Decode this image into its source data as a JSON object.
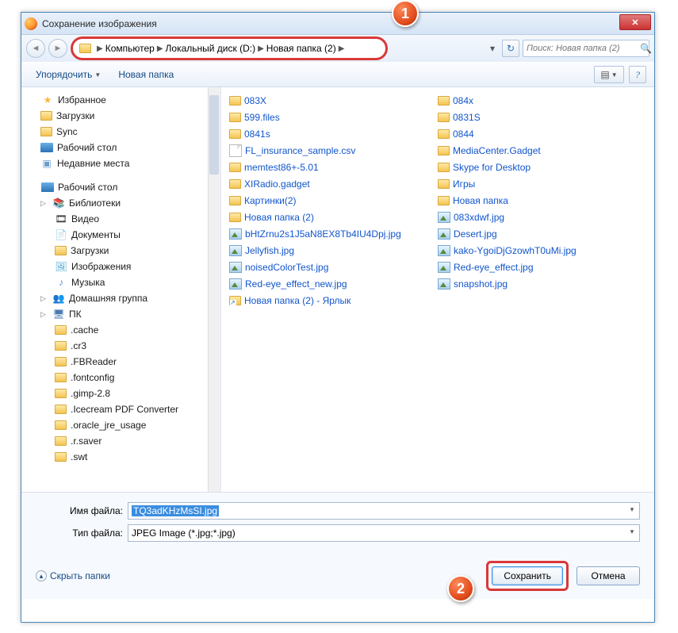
{
  "window": {
    "title": "Сохранение изображения"
  },
  "callouts": {
    "one": "1",
    "two": "2"
  },
  "nav": {
    "crumbs": [
      "Компьютер",
      "Локальный диск (D:)",
      "Новая папка (2)"
    ],
    "search_placeholder": "Поиск: Новая папка (2)"
  },
  "toolbar": {
    "organize": "Упорядочить",
    "new_folder": "Новая папка"
  },
  "sidebar": {
    "favorites": "Избранное",
    "fav_items": [
      "Загрузки",
      "Sync",
      "Рабочий стол",
      "Недавние места"
    ],
    "desktop": "Рабочий стол",
    "libraries": "Библиотеки",
    "lib_items": [
      "Видео",
      "Документы",
      "Загрузки",
      "Изображения",
      "Музыка"
    ],
    "homegroup": "Домашняя группа",
    "computer": "ПК",
    "pc_folders": [
      ".cache",
      ".cr3",
      ".FBReader",
      ".fontconfig",
      ".gimp-2.8",
      ".Icecream PDF Converter",
      ".oracle_jre_usage",
      ".r.saver",
      ".swt"
    ]
  },
  "files": {
    "col1": [
      {
        "t": "folder",
        "n": "083X"
      },
      {
        "t": "folder",
        "n": "599.files"
      },
      {
        "t": "folder",
        "n": "0841s"
      },
      {
        "t": "file",
        "n": "FL_insurance_sample.csv"
      },
      {
        "t": "folder",
        "n": "memtest86+-5.01"
      },
      {
        "t": "folder",
        "n": "XIRadio.gadget"
      },
      {
        "t": "folder",
        "n": "Картинки(2)"
      },
      {
        "t": "folder",
        "n": "Новая папка (2)"
      },
      {
        "t": "img",
        "n": "bHtZrnu2s1J5aN8EX8Tb4IU4Dpj.jpg"
      },
      {
        "t": "img",
        "n": "Jellyfish.jpg"
      },
      {
        "t": "img",
        "n": "noisedColorTest.jpg"
      },
      {
        "t": "img",
        "n": "Red-eye_effect_new.jpg"
      },
      {
        "t": "shortcut",
        "n": "Новая папка (2) - Ярлык"
      }
    ],
    "col2": [
      {
        "t": "folder",
        "n": "084x"
      },
      {
        "t": "folder",
        "n": "0831S"
      },
      {
        "t": "folder",
        "n": "0844"
      },
      {
        "t": "folder",
        "n": "MediaCenter.Gadget"
      },
      {
        "t": "folder",
        "n": "Skype for Desktop"
      },
      {
        "t": "folder",
        "n": "Игры"
      },
      {
        "t": "folder",
        "n": "Новая папка"
      },
      {
        "t": "img",
        "n": "083xdwf.jpg"
      },
      {
        "t": "img",
        "n": "Desert.jpg"
      },
      {
        "t": "img",
        "n": "kako-YgoiDjGzowhT0uMi.jpg"
      },
      {
        "t": "img",
        "n": "Red-eye_effect.jpg"
      },
      {
        "t": "img",
        "n": "snapshot.jpg"
      }
    ]
  },
  "fields": {
    "filename_label": "Имя файла:",
    "filename_value": "TQ3adKHzMsSI.jpg",
    "filetype_label": "Тип файла:",
    "filetype_value": "JPEG Image (*.jpg;*.jpg)"
  },
  "footer": {
    "hide_folders": "Скрыть папки",
    "save": "Сохранить",
    "cancel": "Отмена"
  }
}
